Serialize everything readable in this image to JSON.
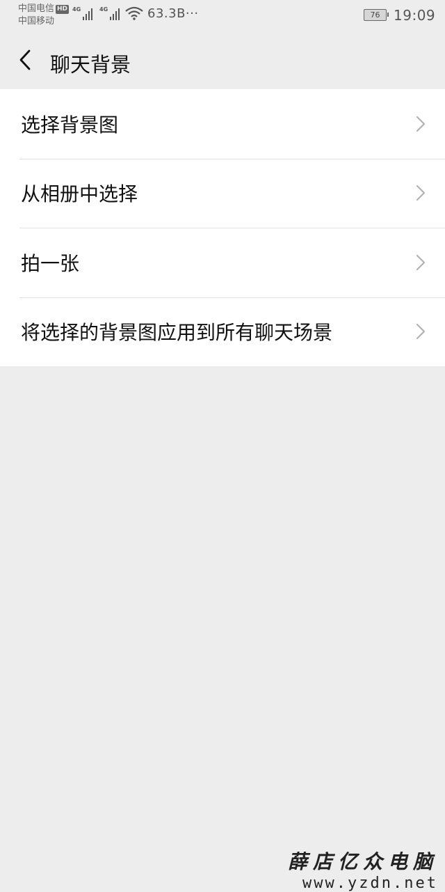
{
  "status_bar": {
    "carrier_1": "中国电信",
    "carrier_1_badge": "HD",
    "carrier_2": "中国移动",
    "signal_1_tag": "4G",
    "signal_2_tag": "4G",
    "net_speed": "63.3B···",
    "battery_level": "76",
    "time": "19:09",
    "wifi_icon": "wifi-icon"
  },
  "nav": {
    "back_icon": "back-chevron-icon",
    "title": "聊天背景"
  },
  "menu": {
    "items": [
      {
        "label": "选择背景图",
        "icon": "chevron-right-icon"
      },
      {
        "label": "从相册中选择",
        "icon": "chevron-right-icon"
      },
      {
        "label": "拍一张",
        "icon": "chevron-right-icon"
      },
      {
        "label": "将选择的背景图应用到所有聊天场景",
        "icon": "chevron-right-icon"
      }
    ]
  },
  "watermark": {
    "name": "薛店亿众电脑",
    "url": "www.yzdn.net"
  },
  "colors": {
    "background": "#ededed",
    "surface": "#ffffff",
    "divider": "#e3e3e3",
    "text": "#111111",
    "chevron": "#b2b2b2"
  }
}
